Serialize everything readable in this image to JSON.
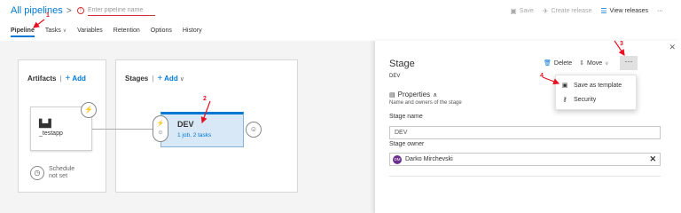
{
  "header": {
    "breadcrumb": "All pipelines",
    "chevron": ">",
    "pipeline_name_placeholder": "Enter pipeline name",
    "actions": [
      {
        "label": "Save",
        "icon": "save-icon",
        "enabled": false
      },
      {
        "label": "Create release",
        "icon": "rocket-icon",
        "enabled": false
      },
      {
        "label": "View releases",
        "icon": "list-icon",
        "enabled": true
      }
    ],
    "more": "···"
  },
  "tabs": [
    {
      "label": "Pipeline",
      "active": true
    },
    {
      "label": "Tasks",
      "active": false,
      "has_dropdown": true
    },
    {
      "label": "Variables",
      "active": false
    },
    {
      "label": "Retention",
      "active": false
    },
    {
      "label": "Options",
      "active": false
    },
    {
      "label": "History",
      "active": false
    }
  ],
  "artifacts": {
    "title": "Artifacts",
    "add_label": "Add",
    "card_name": "_testapp",
    "schedule_line1": "Schedule",
    "schedule_line2": "not set"
  },
  "stages": {
    "title": "Stages",
    "add_label": "Add",
    "card_title": "DEV",
    "card_sub": "1 job, 2 tasks"
  },
  "panel": {
    "title": "Stage",
    "subtitle": "DEV",
    "delete_label": "Delete",
    "move_label": "Move",
    "more": "···",
    "properties_label": "Properties",
    "properties_sub": "Name and owners of the stage",
    "stage_name_label": "Stage name",
    "stage_name_value": "DEV",
    "stage_owner_label": "Stage owner",
    "owner_initials": "DM",
    "owner_name": "Darko Mirchevski"
  },
  "context_menu": {
    "items": [
      {
        "label": "Save as template",
        "icon": "save-template-icon"
      },
      {
        "label": "Security",
        "icon": "security-key-icon"
      }
    ]
  },
  "annotations": {
    "colors": {
      "arrow": "#e81123"
    },
    "labels": [
      "1",
      "2",
      "3",
      "4"
    ]
  },
  "colors": {
    "accent": "#0078d4",
    "error": "#d13438",
    "stage_card_bg": "#d9e8f6",
    "avatar": "#6b2f8f"
  }
}
